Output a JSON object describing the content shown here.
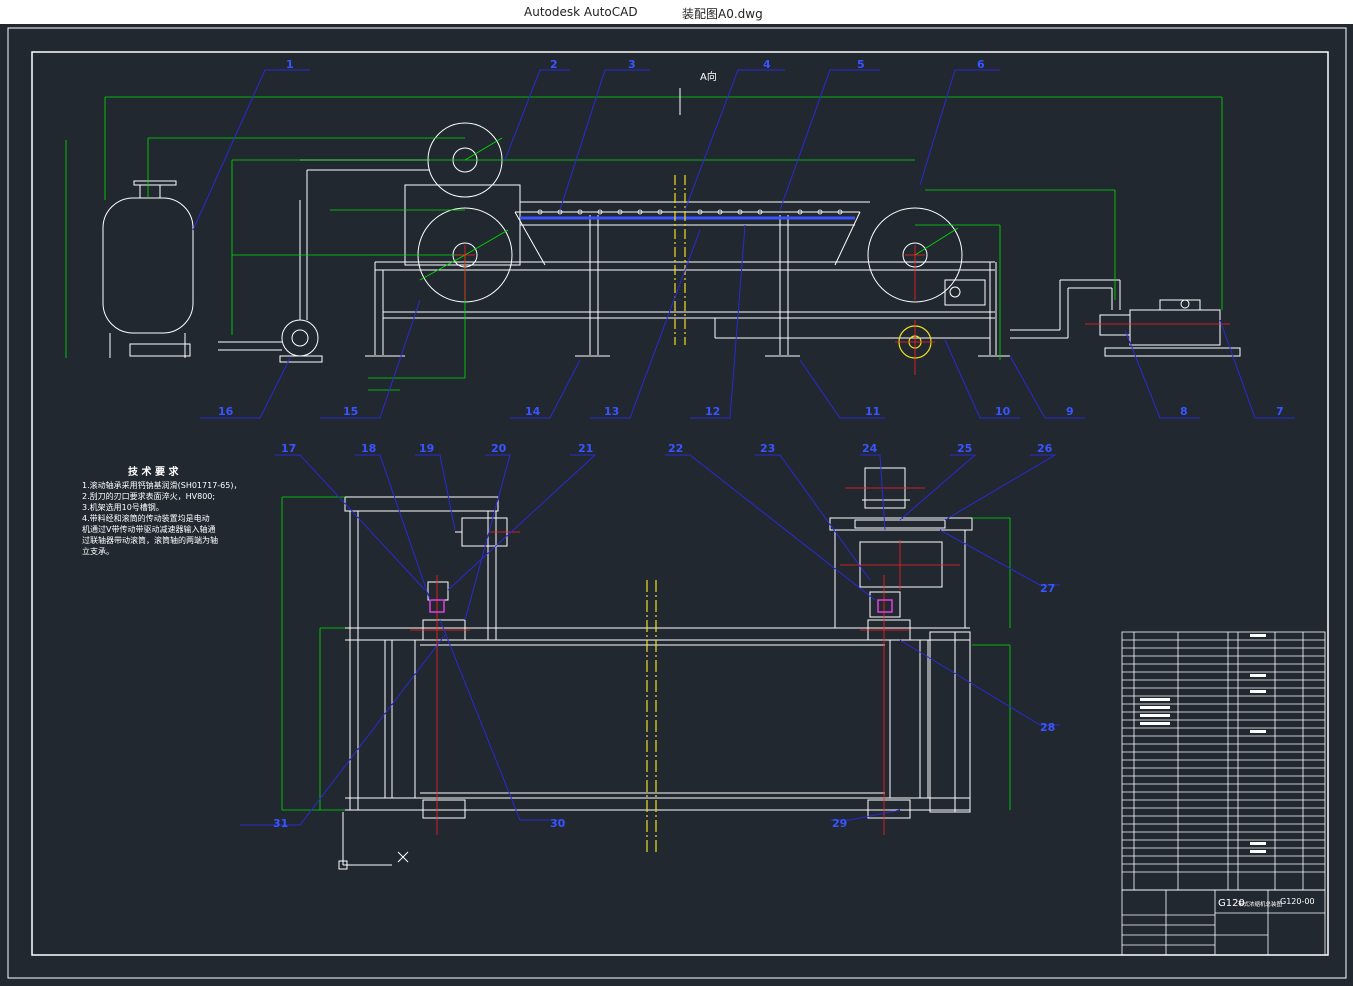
{
  "window": {
    "app_name": "Autodesk AutoCAD",
    "file_name": "装配图A0.dwg"
  },
  "view_label": "A向",
  "balloons_top": [
    "1",
    "2",
    "3",
    "4",
    "5",
    "6",
    "7",
    "8",
    "9",
    "10",
    "11",
    "12",
    "13",
    "14",
    "15",
    "16"
  ],
  "balloons_bottom": [
    "17",
    "18",
    "19",
    "20",
    "21",
    "22",
    "23",
    "24",
    "25",
    "26",
    "27",
    "28",
    "29",
    "30",
    "31"
  ],
  "tech_notes": {
    "title": "技 术 要 求",
    "lines": [
      "1.滚动轴承采用钙钠基润滑(SH01717-65)，",
      "2.刮刀的刃口要求表面淬火，HV800;",
      "3.机架选用10号槽钢。",
      "4.带料经和滚筒的传动装置均是电动",
      "机通过V带传动带驱动减速器输入轴通",
      "过联轴器带动滚筒，滚筒轴的两端为轴",
      "立支承。"
    ]
  },
  "title_block": {
    "drawing_name": "G120",
    "drawing_subtitle": "带式浓缩机总装图",
    "drawing_number": "G120-00"
  },
  "colors": {
    "background": "#212830",
    "white_lines": "#ffffff",
    "dim_green": "#00e000",
    "balloon_blue": "#3a55ff",
    "leader_blue": "#2a2ad0",
    "center_red": "#ff2020",
    "yellow": "#f0e020",
    "magenta": "#e040e0"
  }
}
